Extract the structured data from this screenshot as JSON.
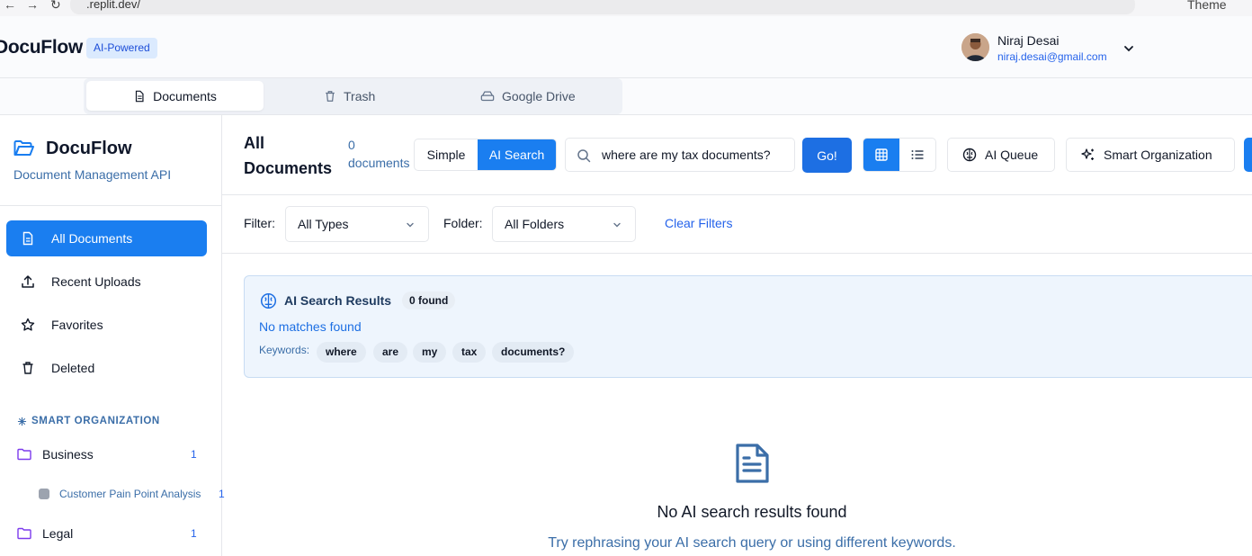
{
  "browser": {
    "url": ".replit.dev/",
    "theme_label": "Theme"
  },
  "header": {
    "app_name": "DocuFlow",
    "badge": "AI-Powered",
    "user": {
      "name": "Niraj Desai",
      "email": "niraj.desai@gmail.com"
    }
  },
  "tabs": [
    {
      "label": "Documents",
      "active": true
    },
    {
      "label": "Trash",
      "active": false
    },
    {
      "label": "Google Drive",
      "active": false
    }
  ],
  "sidebar": {
    "title": "DocuFlow",
    "subtitle": "Document Management API",
    "nav": [
      {
        "label": "All Documents",
        "icon": "document-icon",
        "active": true
      },
      {
        "label": "Recent Uploads",
        "icon": "upload-icon",
        "active": false
      },
      {
        "label": "Favorites",
        "icon": "star-icon",
        "active": false
      },
      {
        "label": "Deleted",
        "icon": "trash-icon",
        "active": false
      }
    ],
    "smart_heading": "SMART ORGANIZATION",
    "folders": [
      {
        "label": "Business",
        "count": "1"
      },
      {
        "label": "Legal",
        "count": "1"
      }
    ],
    "subfolders": [
      {
        "label": "Customer Pain Point Analysis",
        "count": "1"
      }
    ]
  },
  "toolbar": {
    "title": "All Documents",
    "doc_count": "0 documents",
    "mode_simple": "Simple",
    "mode_ai": "AI Search",
    "search_value": "where are my tax documents?",
    "go_label": "Go!",
    "ai_queue_label": "AI Queue",
    "smart_org_label": "Smart Organization"
  },
  "filters": {
    "filter_label": "Filter:",
    "type_value": "All Types",
    "folder_label": "Folder:",
    "folder_value": "All Folders",
    "clear_label": "Clear Filters"
  },
  "ai_results": {
    "title": "AI Search Results",
    "found": "0 found",
    "message": "No matches found",
    "keywords_label": "Keywords:",
    "keywords": [
      "where",
      "are",
      "my",
      "tax",
      "documents?"
    ]
  },
  "empty_state": {
    "title": "No AI search results found",
    "subtitle": "Try rephrasing your AI search query or using different keywords."
  },
  "colors": {
    "primary": "#1a7ef0",
    "go_button": "#1d6fe3",
    "link": "#2563eb",
    "muted_text": "#3b6ea8",
    "card_bg": "#eef5fd"
  }
}
